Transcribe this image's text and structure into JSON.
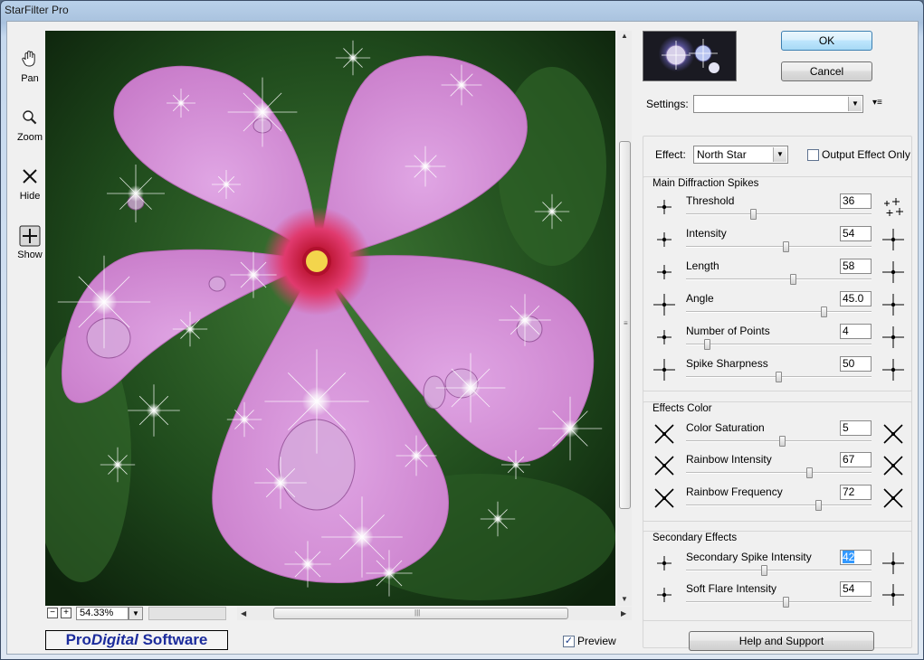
{
  "window": {
    "title": "StarFilter Pro"
  },
  "tools": [
    {
      "label": "Pan",
      "icon": "hand-icon"
    },
    {
      "label": "Zoom",
      "icon": "magnifier-icon"
    },
    {
      "label": "Hide",
      "icon": "x-icon"
    },
    {
      "label": "Show",
      "icon": "plus-icon"
    }
  ],
  "zoom": {
    "value": "54.33%",
    "minus": "−",
    "plus": "+"
  },
  "brand": {
    "pro": "Pro",
    "digital": "Digital",
    "software": " Software"
  },
  "preview_checkbox": {
    "label": "Preview",
    "checked": true
  },
  "buttons": {
    "ok": "OK",
    "cancel": "Cancel",
    "help": "Help and Support"
  },
  "settings": {
    "label": "Settings:",
    "value": ""
  },
  "effect": {
    "label": "Effect:",
    "value": "North Star"
  },
  "output_only": {
    "label": "Output Effect Only",
    "checked": false
  },
  "groups": [
    {
      "title": "Main Diffraction Spikes",
      "rows": [
        {
          "name": "Threshold",
          "value": "36",
          "fraction": 0.36
        },
        {
          "name": "Intensity",
          "value": "54",
          "fraction": 0.54
        },
        {
          "name": "Length",
          "value": "58",
          "fraction": 0.58
        },
        {
          "name": "Angle",
          "value": "45.0",
          "fraction": 0.75
        },
        {
          "name": "Number of Points",
          "value": "4",
          "fraction": 0.1
        },
        {
          "name": "Spike Sharpness",
          "value": "50",
          "fraction": 0.5
        }
      ]
    },
    {
      "title": "Effects Color",
      "rows": [
        {
          "name": "Color Saturation",
          "value": "5",
          "fraction": 0.52
        },
        {
          "name": "Rainbow Intensity",
          "value": "67",
          "fraction": 0.67
        },
        {
          "name": "Rainbow Frequency",
          "value": "72",
          "fraction": 0.72
        }
      ]
    },
    {
      "title": "Secondary Effects",
      "rows": [
        {
          "name": "Secondary Spike Intensity",
          "value": "42",
          "fraction": 0.42,
          "selected": true
        },
        {
          "name": "Soft Flare Intensity",
          "value": "54",
          "fraction": 0.54
        }
      ]
    }
  ]
}
